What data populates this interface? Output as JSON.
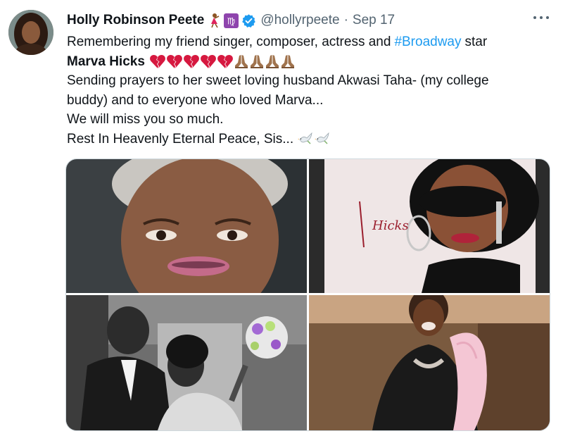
{
  "tweet": {
    "author_name": "Holly Robinson Peete",
    "handle": "@hollyrpeete",
    "separator": "·",
    "date": "Sep 17",
    "name_emojis": [
      "dancer-emoji",
      "virgo-emoji",
      "verified-badge-icon"
    ],
    "body": {
      "line1_text": "Remembering my friend singer, composer, actress and",
      "hashtag": "#Broadway",
      "line1_tail": "star",
      "line2_bold": "Marva Hicks",
      "line2_emojis": [
        "broken-heart-emoji",
        "broken-heart-emoji",
        "broken-heart-emoji",
        "broken-heart-emoji",
        "broken-heart-emoji",
        "praying-hands-emoji",
        "praying-hands-emoji",
        "praying-hands-emoji",
        "praying-hands-emoji"
      ],
      "line3": "Sending prayers to her sweet loving husband Akwasi Taha- (my college",
      "line4": "buddy) and to everyone who loved Marva...",
      "line5": "We will miss you so much.",
      "line6": "Rest In Heavenly Eternal Peace, Sis...",
      "line6_emojis": [
        "dove-emoji",
        "dove-emoji"
      ]
    },
    "media": [
      {
        "name": "photo-marva-portrait"
      },
      {
        "name": "photo-album-cover",
        "album_text": "Hicks"
      },
      {
        "name": "photo-wedding"
      },
      {
        "name": "photo-marva-smiling"
      }
    ],
    "colors": {
      "link": "#1d9bf0",
      "secondary": "#536471",
      "verified": "#1d9bf0",
      "heart": "#d6183f",
      "virgo": "#8e44ad"
    }
  }
}
